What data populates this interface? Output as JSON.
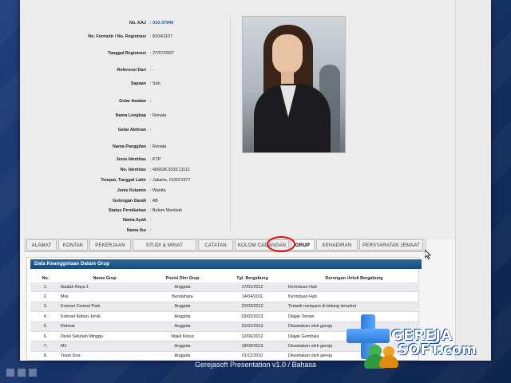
{
  "profile": {
    "rows": [
      {
        "label": "No. KAJ",
        "value": ": 010-37949"
      },
      {
        "label": "No. Formulir / No. Registrasi",
        "value": ": 8104/1107"
      },
      {
        "label": "Tanggal Registrasi",
        "value": ": 27/07/2007"
      },
      {
        "label": "Referensi Dari",
        "value": ": -"
      },
      {
        "label": "Sapaan",
        "value": ": Sdri."
      },
      {
        "label": "Gelar Awalan",
        "value": ":"
      },
      {
        "label": "Nama Lengkap",
        "value": ": Renata"
      },
      {
        "label": "Gelar Akhiran",
        "value": ":"
      },
      {
        "label": "Nama Panggilan",
        "value": ": Renata"
      },
      {
        "label": "Jenis Identitas",
        "value": ": KTP"
      },
      {
        "label": "No. Identitas",
        "value": ": 456636.3333.11112"
      },
      {
        "label": "Tempat, Tanggal Lahir",
        "value": ": Jakarta, 01/02/1977"
      },
      {
        "label": "Jenis Kelamin",
        "value": ": Wanita"
      },
      {
        "label": "Golongan Darah",
        "value": ": AB"
      },
      {
        "label": "Status Pernikahan",
        "value": ": Belum Menikah"
      },
      {
        "label": "Nama Ayah",
        "value": ":"
      },
      {
        "label": "Nama Ibu",
        "value": ":"
      }
    ]
  },
  "tabs": [
    {
      "label": "ALAMAT"
    },
    {
      "label": "KONTAK"
    },
    {
      "label": "PEKERJAAN"
    },
    {
      "label": "STUDI & MINAT"
    },
    {
      "label": "CATATAN"
    },
    {
      "label": "KOLOM CADANGAN"
    },
    {
      "label": "GRUP"
    },
    {
      "label": "KEHADIRAN"
    },
    {
      "label": "PERSYARATAN JEMAAT"
    }
  ],
  "group": {
    "title": "Data Keanggotaan Dalam Grup",
    "columns": [
      "No.",
      "Nama Grup",
      "Posisi Dlm Grup",
      "Tgl. Bergabung",
      "Dorongan Untuk Bergabung"
    ],
    "rows": [
      [
        "1.",
        "Ibadah Raya 1",
        "Anggota",
        "17/01/2012",
        "Kerinduan Hati"
      ],
      [
        "2.",
        "Misi",
        "Bendahara",
        "14/04/2011",
        "Kerinduan Hati"
      ],
      [
        "3.",
        "Komsel Central Park",
        "Anggota",
        "22/03/2012",
        "Tertarik melayani di bidang tersebut"
      ],
      [
        "4.",
        "Komsel Kebun Jeruk",
        "Anggota",
        "03/02/2013",
        "Diajak Teman"
      ],
      [
        "5.",
        "Retreat",
        "Anggota",
        "31/01/2013",
        "Diwartakan oleh gereja"
      ],
      [
        "6.",
        "Divisi Sekolah Minggu",
        "Wakil Ketua",
        "12/06/2012",
        "Diajak Gembala"
      ],
      [
        "7.",
        "M1",
        "Anggota",
        "18/09/2013",
        "Diwartakan oleh gereja"
      ],
      [
        "8.",
        "Team Doa",
        "Anggota",
        "01/11/2010",
        "Diwartakan oleh gereja"
      ]
    ]
  },
  "logo": {
    "line1": "GEREJA",
    "line2": "SOFT.com"
  },
  "footer": {
    "text": "Gerejasoft Presentation v1.0 / Bahasa"
  },
  "colors": {
    "header_blue": "#1d5688",
    "highlight_circle": "#e01010",
    "kaj_blue": "#2255aa"
  },
  "icons": {
    "cursor": "mouse-pointer-icon"
  }
}
